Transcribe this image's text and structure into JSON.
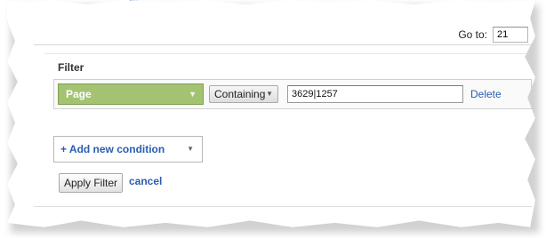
{
  "pagination": {
    "goto_label": "Go to:",
    "goto_value": "21"
  },
  "filter": {
    "title": "Filter",
    "condition": {
      "dimension": "Page",
      "match_type": "Containing",
      "value": "3629|1257",
      "delete_label": "Delete"
    },
    "add_condition_label": "+ Add new condition",
    "apply_label": "Apply Filter",
    "cancel_label": "cancel"
  },
  "icons": {
    "dropdown": "chevron-down-icon"
  },
  "colors": {
    "dimension_bg": "#a3c373",
    "link": "#2a5db0"
  }
}
